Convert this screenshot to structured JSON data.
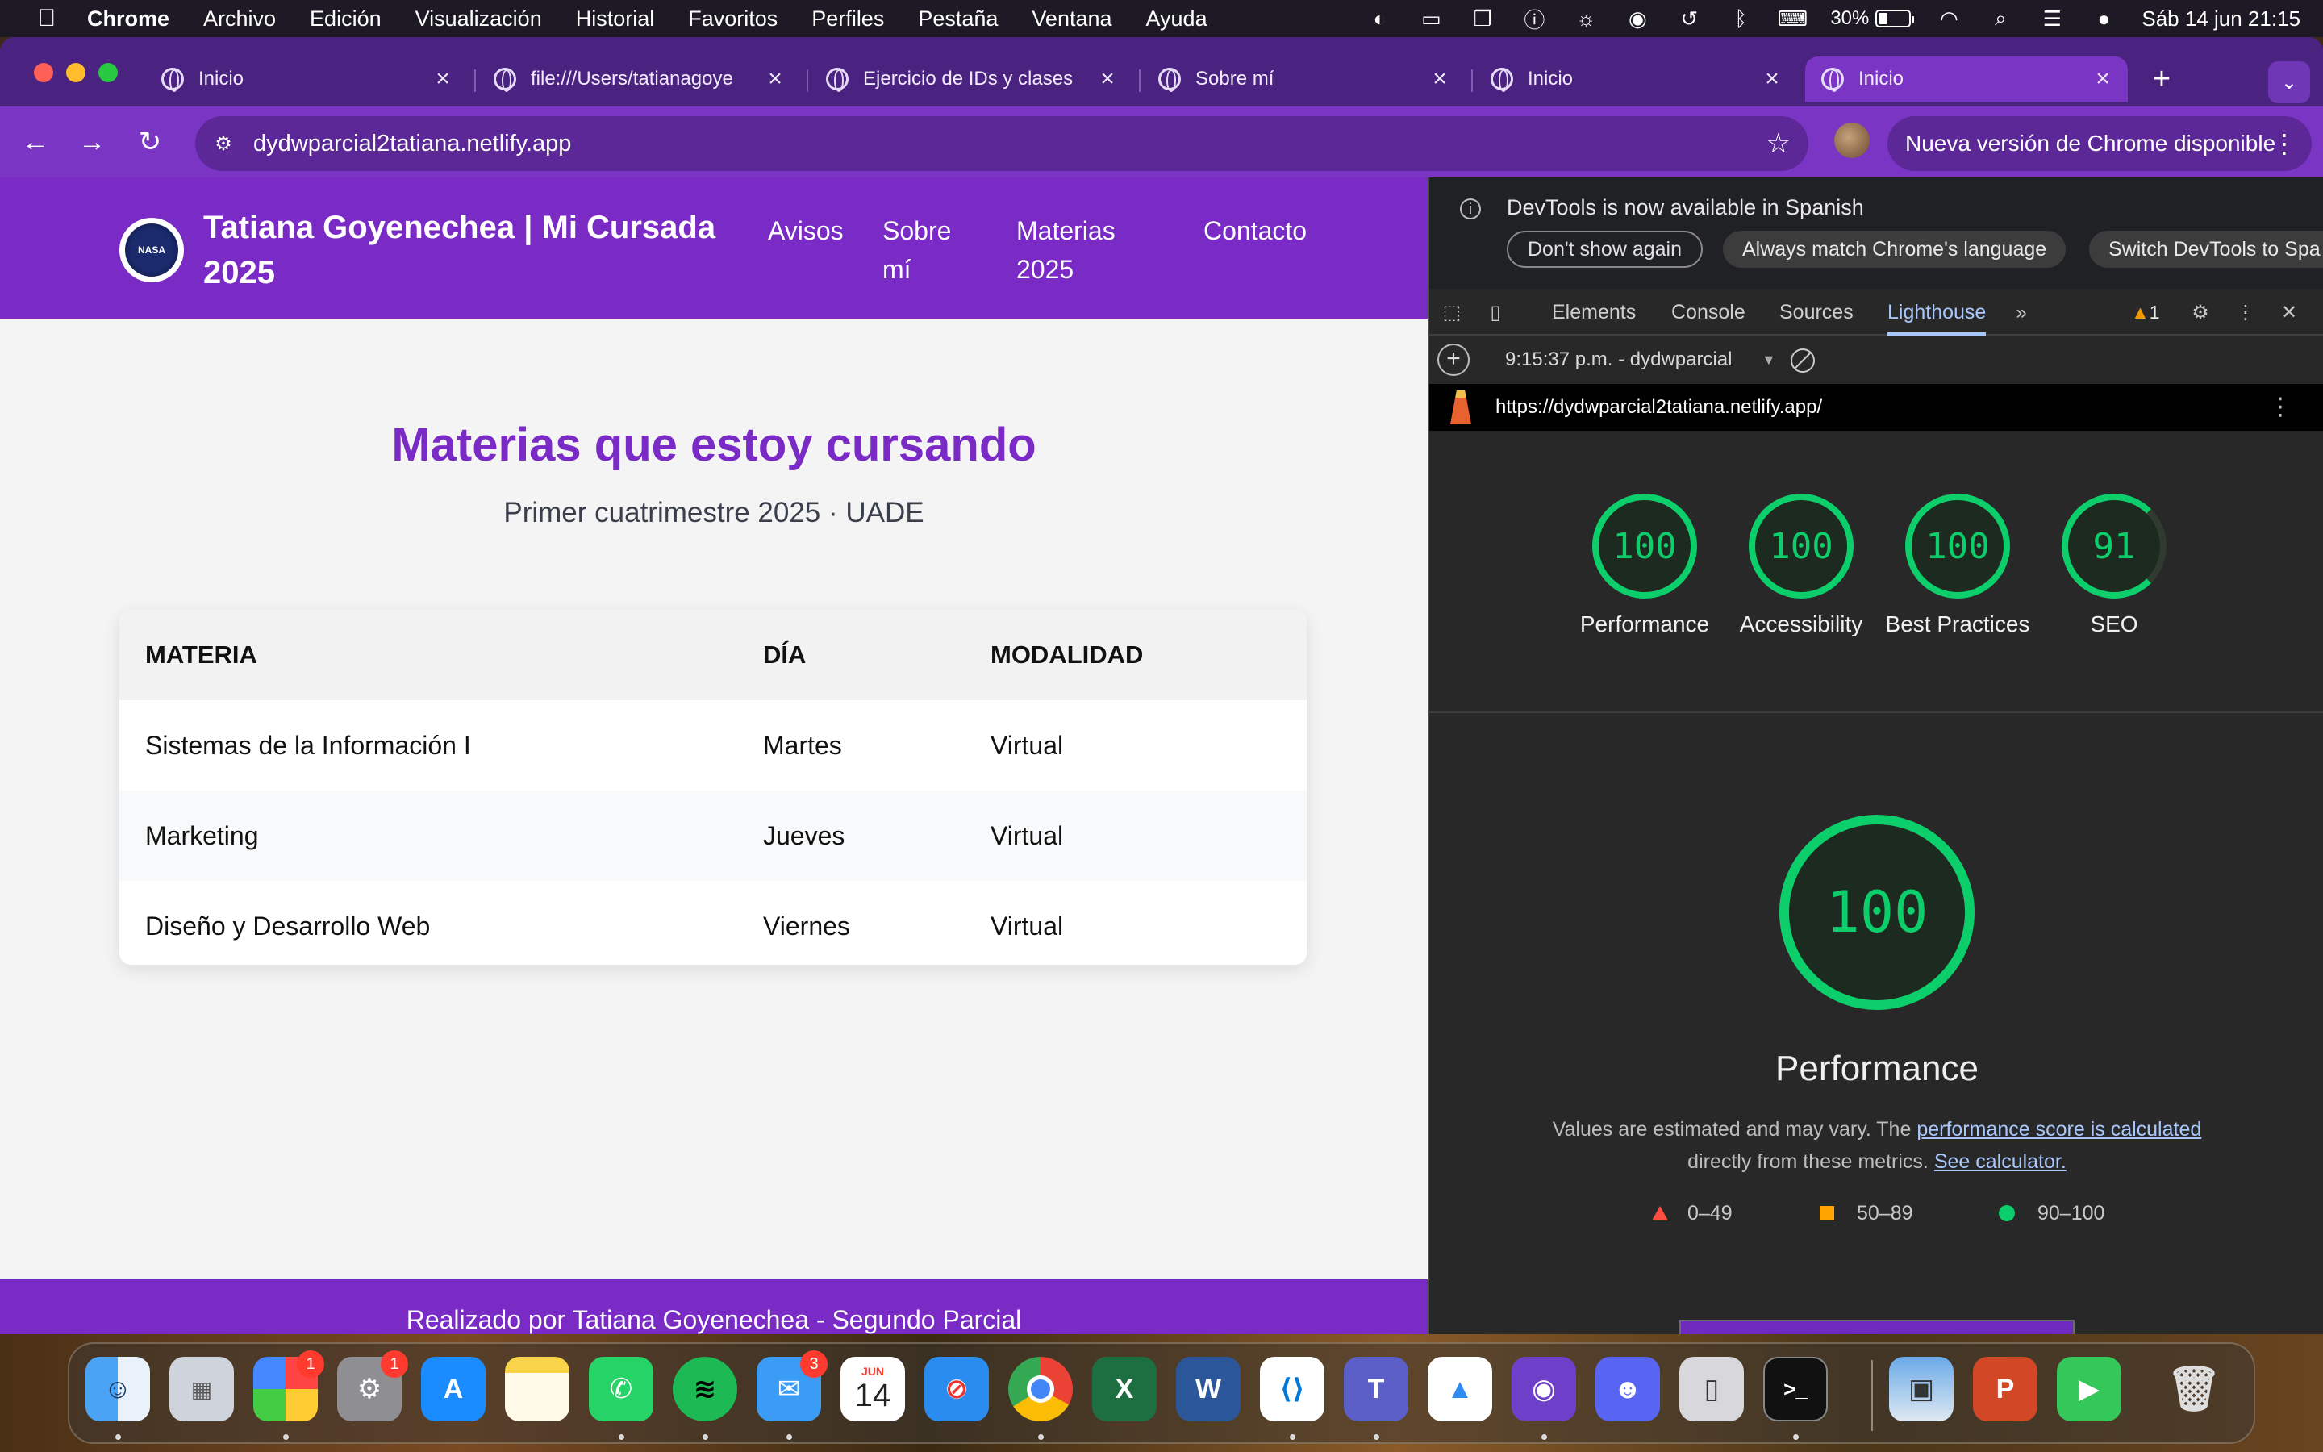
{
  "menubar": {
    "apple": "",
    "app": "Chrome",
    "items": [
      "Archivo",
      "Edición",
      "Visualización",
      "Historial",
      "Favoritos",
      "Perfiles",
      "Pestaña",
      "Ventana",
      "Ayuda"
    ],
    "battery": "30%",
    "battery_level": 0.3,
    "clock": "Sáb 14 jun  21:15"
  },
  "browser": {
    "tabs": [
      {
        "title": "Inicio"
      },
      {
        "title": "file:///Users/tatianagoye"
      },
      {
        "title": "Ejercicio de IDs y clases"
      },
      {
        "title": "Sobre mí"
      },
      {
        "title": "Inicio"
      },
      {
        "title": "Inicio"
      }
    ],
    "url": "dydwparcial2tatiana.netlify.app",
    "update_button": "Nueva versión de Chrome disponible"
  },
  "site": {
    "title": "Tatiana Goyenechea | Mi Cursada 2025",
    "logo_text": "NASA",
    "nav": [
      "Avisos",
      "Sobre mí",
      "Materias 2025",
      "Contacto"
    ],
    "heading": "Materias que estoy cursando",
    "subheading": "Primer cuatrimestre 2025 · UADE",
    "table": {
      "headers": [
        "MATERIA",
        "DÍA",
        "MODALIDAD"
      ],
      "rows": [
        [
          "Sistemas de la Información I",
          "Martes",
          "Virtual"
        ],
        [
          "Marketing",
          "Jueves",
          "Virtual"
        ],
        [
          "Diseño y Desarrollo Web",
          "Viernes",
          "Virtual"
        ]
      ]
    },
    "footer": "Realizado por Tatiana Goyenechea - Segundo Parcial",
    "brand_color": "#7a2ac5"
  },
  "devtools": {
    "info_message": "DevTools is now available in Spanish",
    "buttons": [
      "Don't show again",
      "Always match Chrome's language",
      "Switch DevTools to Spa"
    ],
    "tabs": [
      "Elements",
      "Console",
      "Sources",
      "Lighthouse"
    ],
    "warning_count": "1",
    "report_label": "9:15:37 p.m. - dydwparcial",
    "report_url": "https://dydwparcial2tatiana.netlify.app/",
    "scores": [
      {
        "value": "100",
        "label": "Performance"
      },
      {
        "value": "100",
        "label": "Accessibility"
      },
      {
        "value": "100",
        "label": "Best Practices"
      },
      {
        "value": "91",
        "label": "SEO"
      }
    ],
    "main_score": "100",
    "main_label": "Performance",
    "description": {
      "before": "Values are estimated and may vary. The ",
      "link1": "performance score is calculated",
      "middle": " directly from these metrics. ",
      "link2": "See calculator."
    },
    "legend": [
      "0–49",
      "50–89",
      "90–100"
    ],
    "score_color": "#0cce6b"
  },
  "dock": {
    "apps": [
      {
        "name": "Finder",
        "icon": "finder-icon"
      },
      {
        "name": "Launchpad",
        "icon": "launchpad-icon"
      },
      {
        "name": "Fotos",
        "icon": "photos-icon",
        "badge": "1"
      },
      {
        "name": "Ajustes",
        "icon": "settings-icon",
        "badge": "1"
      },
      {
        "name": "App Store",
        "icon": "appstore-icon"
      },
      {
        "name": "Notas",
        "icon": "notes-icon"
      },
      {
        "name": "WhatsApp",
        "icon": "whatsapp-icon"
      },
      {
        "name": "Spotify",
        "icon": "spotify-icon"
      },
      {
        "name": "Mail",
        "icon": "mail-icon",
        "badge": "3"
      },
      {
        "name": "Calendario",
        "icon": "calendar-icon",
        "month": "JUN",
        "day": "14"
      },
      {
        "name": "Safari",
        "icon": "safari-icon"
      },
      {
        "name": "Chrome",
        "icon": "chrome-icon"
      },
      {
        "name": "Excel",
        "icon": "excel-icon",
        "glyph": "X"
      },
      {
        "name": "Word",
        "icon": "word-icon",
        "glyph": "W"
      },
      {
        "name": "VS Code",
        "icon": "vscode-icon"
      },
      {
        "name": "Teams",
        "icon": "teams-icon",
        "glyph": "T"
      },
      {
        "name": "Keynote",
        "icon": "keynote-icon"
      },
      {
        "name": "GitHub Desktop",
        "icon": "github-icon"
      },
      {
        "name": "Discord",
        "icon": "discord-icon"
      },
      {
        "name": "iPhone Mirroring",
        "icon": "iphone-icon"
      },
      {
        "name": "Terminal",
        "icon": "terminal-icon",
        "glyph": ">_"
      },
      {
        "name": "Preview",
        "icon": "preview-icon"
      },
      {
        "name": "PowerPoint",
        "icon": "powerpoint-icon",
        "glyph": "P"
      },
      {
        "name": "FaceTime",
        "icon": "facetime-icon"
      },
      {
        "name": "Papelera",
        "icon": "trash-icon"
      }
    ]
  }
}
